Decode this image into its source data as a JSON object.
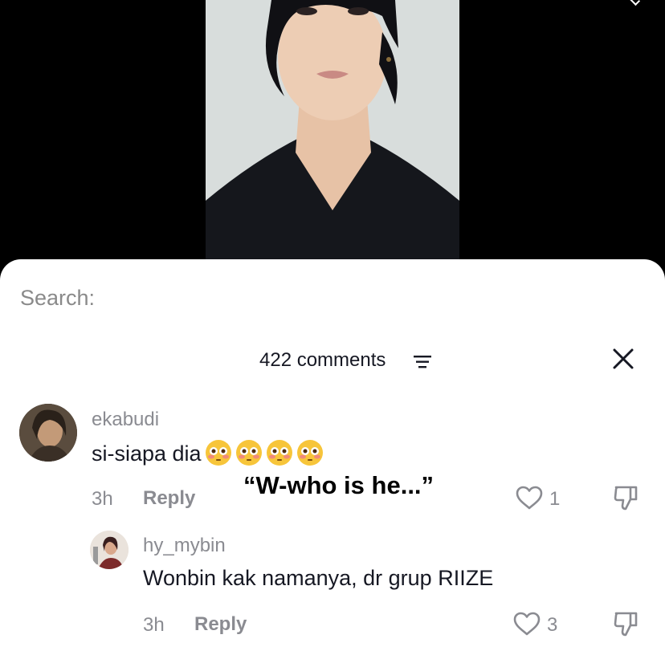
{
  "search": {
    "label": "Search:"
  },
  "header": {
    "comments_count": "422 comments"
  },
  "comments": [
    {
      "username": "ekabudi",
      "text": "si-siapa dia",
      "emojis": [
        "flushed-face",
        "flushed-face",
        "flushed-face",
        "flushed-face"
      ],
      "time": "3h",
      "reply_label": "Reply",
      "likes": "1"
    },
    {
      "username": "hy_mybin",
      "text": "Wonbin kak namanya, dr grup RIIZE",
      "time": "3h",
      "reply_label": "Reply",
      "likes": "3"
    }
  ],
  "annotation": "“W-who is he...”",
  "colors": {
    "sheet_bg": "#ffffff",
    "muted_text": "#8a8b91",
    "primary_text": "#161823"
  }
}
